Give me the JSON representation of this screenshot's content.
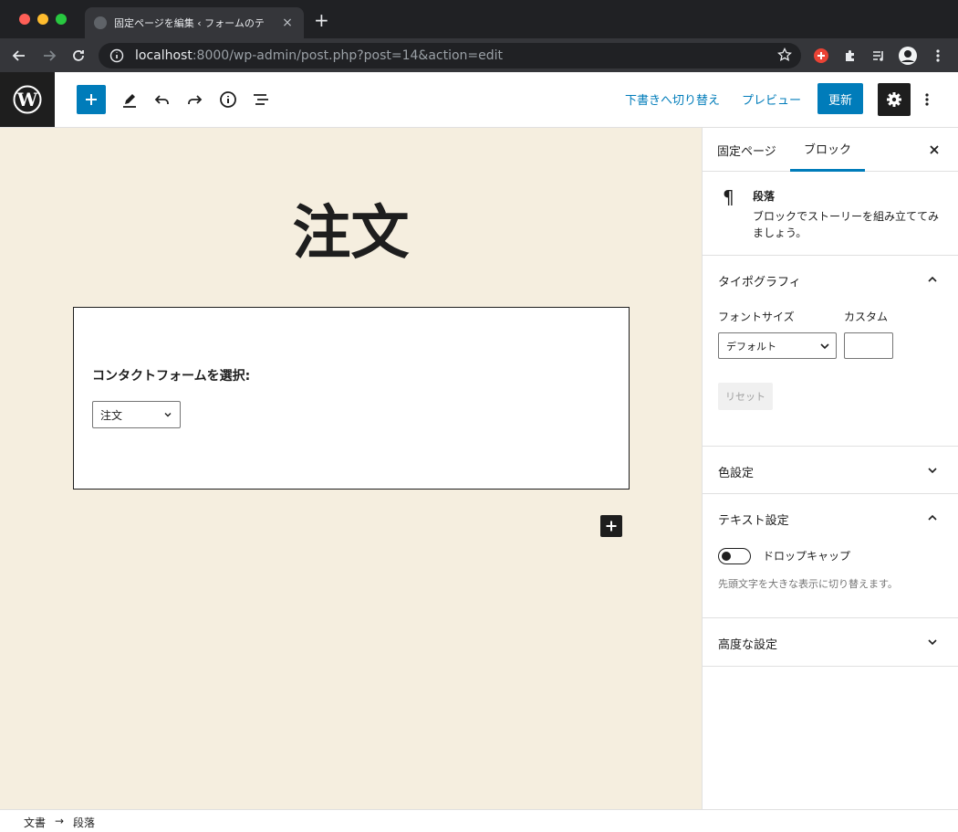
{
  "browser": {
    "tab_title": "固定ページを編集 ‹ フォームのテ",
    "tab_close": "×",
    "new_tab": "+",
    "url_host": "localhost",
    "url_rest": ":8000/wp-admin/post.php?post=14&action=edit"
  },
  "header": {
    "switch_to_draft": "下書きへ切り替え",
    "preview": "プレビュー",
    "update": "更新"
  },
  "content": {
    "post_title": "注文",
    "form_label": "コンタクトフォームを選択:",
    "form_select_value": "注文"
  },
  "sidebar": {
    "tabs": [
      "固定ページ",
      "ブロック"
    ],
    "active_tab": "ブロック",
    "block_card": {
      "title": "段落",
      "description": "ブロックでストーリーを組み立ててみましょう。"
    },
    "typography": {
      "title": "タイポグラフィ",
      "font_size_label": "フォントサイズ",
      "custom_label": "カスタム",
      "font_size_value": "デフォルト",
      "reset": "リセット"
    },
    "color": {
      "title": "色設定"
    },
    "text_settings": {
      "title": "テキスト設定",
      "drop_cap_label": "ドロップキャップ",
      "drop_cap_help": "先頭文字を大きな表示に切り替えます。"
    },
    "advanced": {
      "title": "高度な設定"
    }
  },
  "footer": {
    "breadcrumb": [
      "文書",
      "段落"
    ],
    "separator": "→"
  },
  "colors": {
    "accent": "#007cba",
    "canvas_bg": "#f5eedf",
    "dark": "#1e1e1e"
  }
}
